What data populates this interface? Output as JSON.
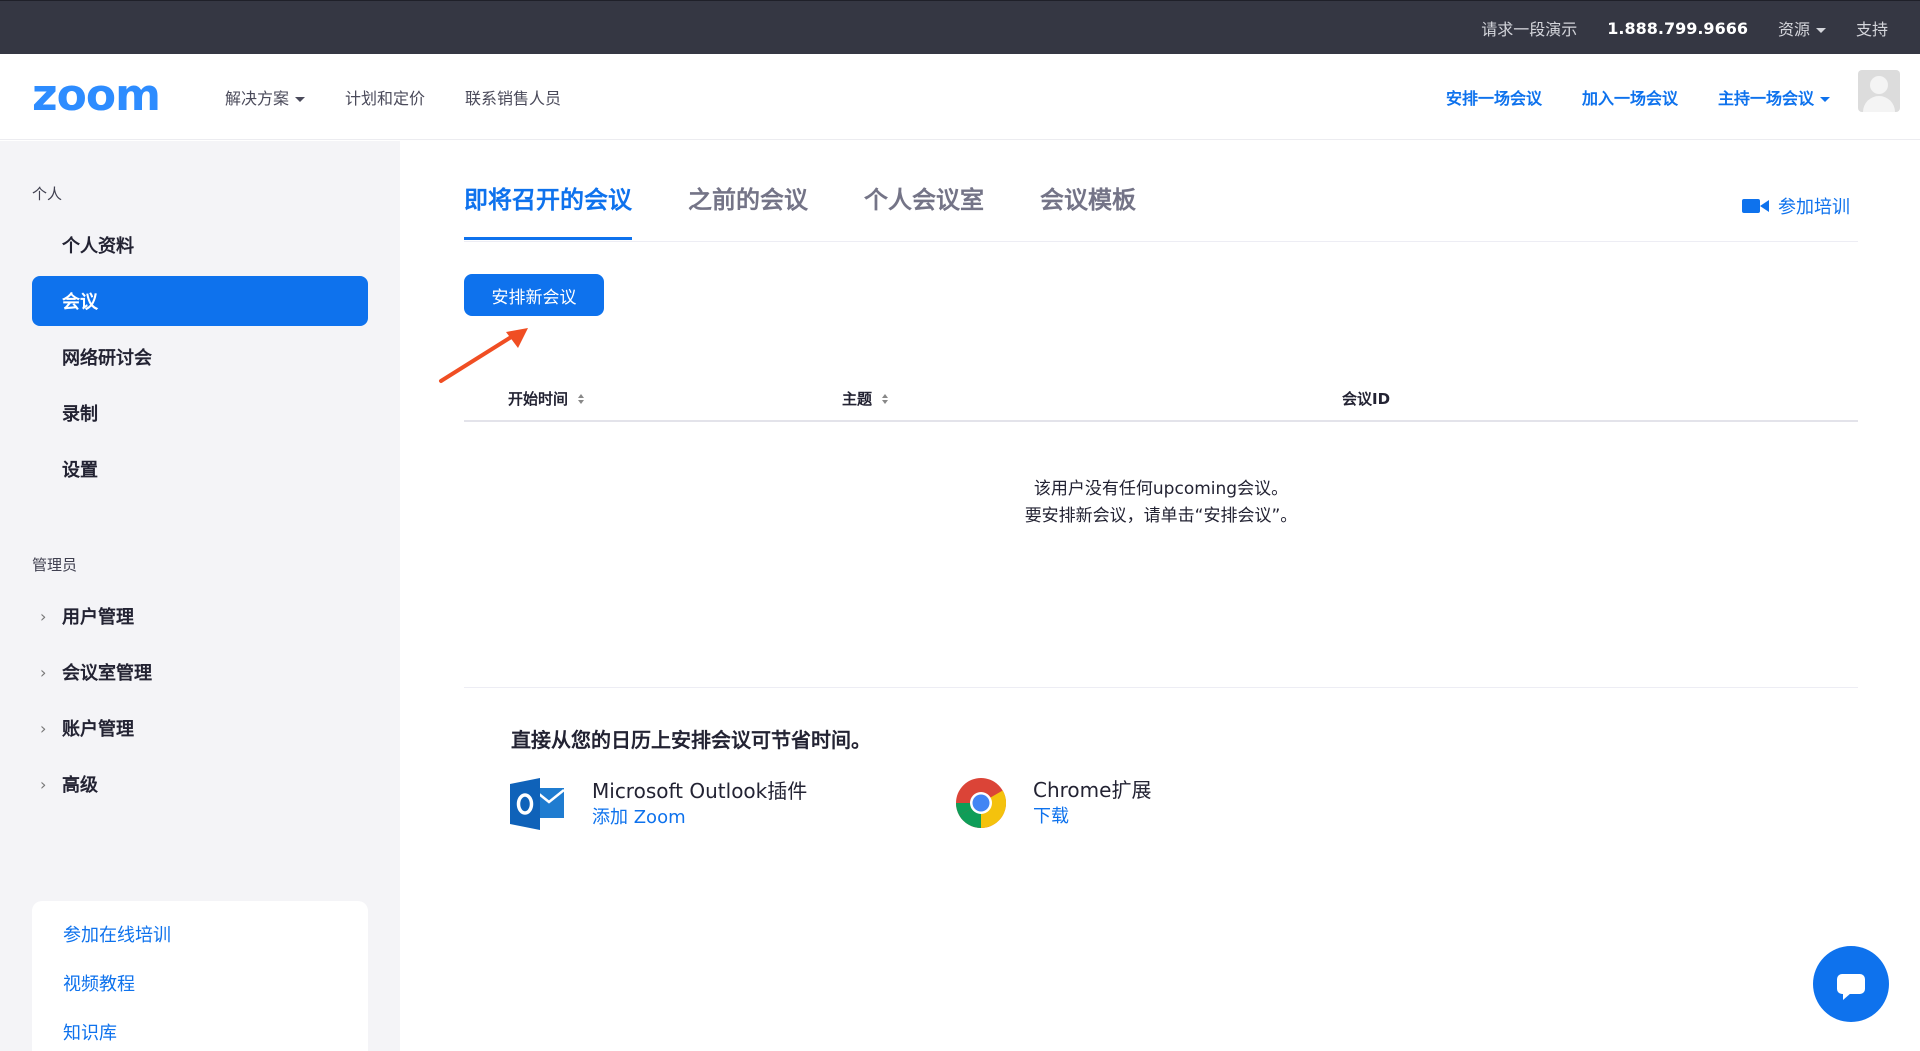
{
  "topbar": {
    "demo": "请求一段演示",
    "phone": "1.888.799.9666",
    "resources": "资源",
    "support": "支持"
  },
  "nav": {
    "logo": "zoom",
    "solutions": "解决方案",
    "pricing": "计划和定价",
    "contact_sales": "联系销售人员",
    "schedule": "安排一场会议",
    "join": "加入一场会议",
    "host": "主持一场会议"
  },
  "sidebar": {
    "personal_heading": "个人",
    "personal_items": [
      {
        "label": "个人资料"
      },
      {
        "label": "会议"
      },
      {
        "label": "网络研讨会"
      },
      {
        "label": "录制"
      },
      {
        "label": "设置"
      }
    ],
    "admin_heading": "管理员",
    "admin_items": [
      {
        "label": "用户管理"
      },
      {
        "label": "会议室管理"
      },
      {
        "label": "账户管理"
      },
      {
        "label": "高级"
      }
    ],
    "help_links": [
      {
        "label": "参加在线培训"
      },
      {
        "label": "视频教程"
      },
      {
        "label": "知识库"
      }
    ]
  },
  "main": {
    "tabs": [
      {
        "label": "即将召开的会议"
      },
      {
        "label": "之前的会议"
      },
      {
        "label": "个人会议室"
      },
      {
        "label": "会议模板"
      }
    ],
    "training_link": "参加培训",
    "schedule_button": "安排新会议",
    "table_headers": {
      "start_time": "开始时间",
      "topic": "主题",
      "meeting_id": "会议ID"
    },
    "empty_line1": "该用户没有任何upcoming会议。",
    "empty_line2": "要安排新会议，请单击“安排会议”。",
    "calendar_title": "直接从您的日历上安排会议可节省时间。",
    "integrations": [
      {
        "name": "Microsoft Outlook插件",
        "link": "添加 Zoom"
      },
      {
        "name": "Chrome扩展",
        "link": "下载"
      }
    ]
  },
  "colors": {
    "accent": "#0e72ed",
    "topbar_bg": "#353743",
    "sidebar_bg": "#f4f4f7",
    "annotation_arrow": "#f04e23"
  }
}
